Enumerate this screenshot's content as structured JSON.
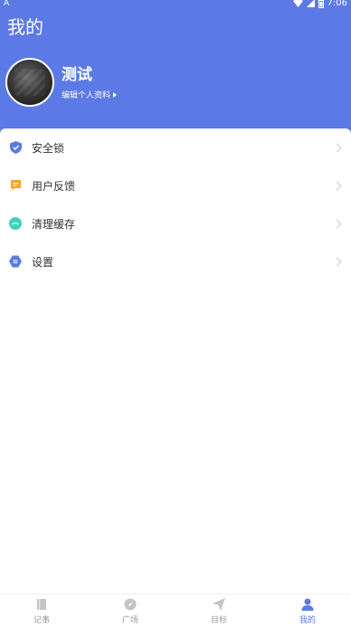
{
  "status_bar": {
    "left_glyph": "A",
    "time": "7:06"
  },
  "header": {
    "title": "我的"
  },
  "profile": {
    "name": "测试",
    "edit_label": "编辑个人资料"
  },
  "menu": {
    "items": [
      {
        "label": "安全锁",
        "icon": "shield-icon",
        "color": "#5c7ae6"
      },
      {
        "label": "用户反馈",
        "icon": "feedback-icon",
        "color": "#f5a623"
      },
      {
        "label": "清理缓存",
        "icon": "clean-cache-icon",
        "color": "#3fcfc6"
      },
      {
        "label": "设置",
        "icon": "settings-icon",
        "color": "#5c7ae6"
      }
    ]
  },
  "tabbar": {
    "tabs": [
      {
        "label": "记事",
        "icon": "notebook-icon"
      },
      {
        "label": "广场",
        "icon": "compass-icon"
      },
      {
        "label": "目标",
        "icon": "send-icon"
      },
      {
        "label": "我的",
        "icon": "user-icon",
        "active": true
      }
    ]
  },
  "colors": {
    "primary": "#5c7ae6",
    "inactive": "#9a9a9a"
  }
}
